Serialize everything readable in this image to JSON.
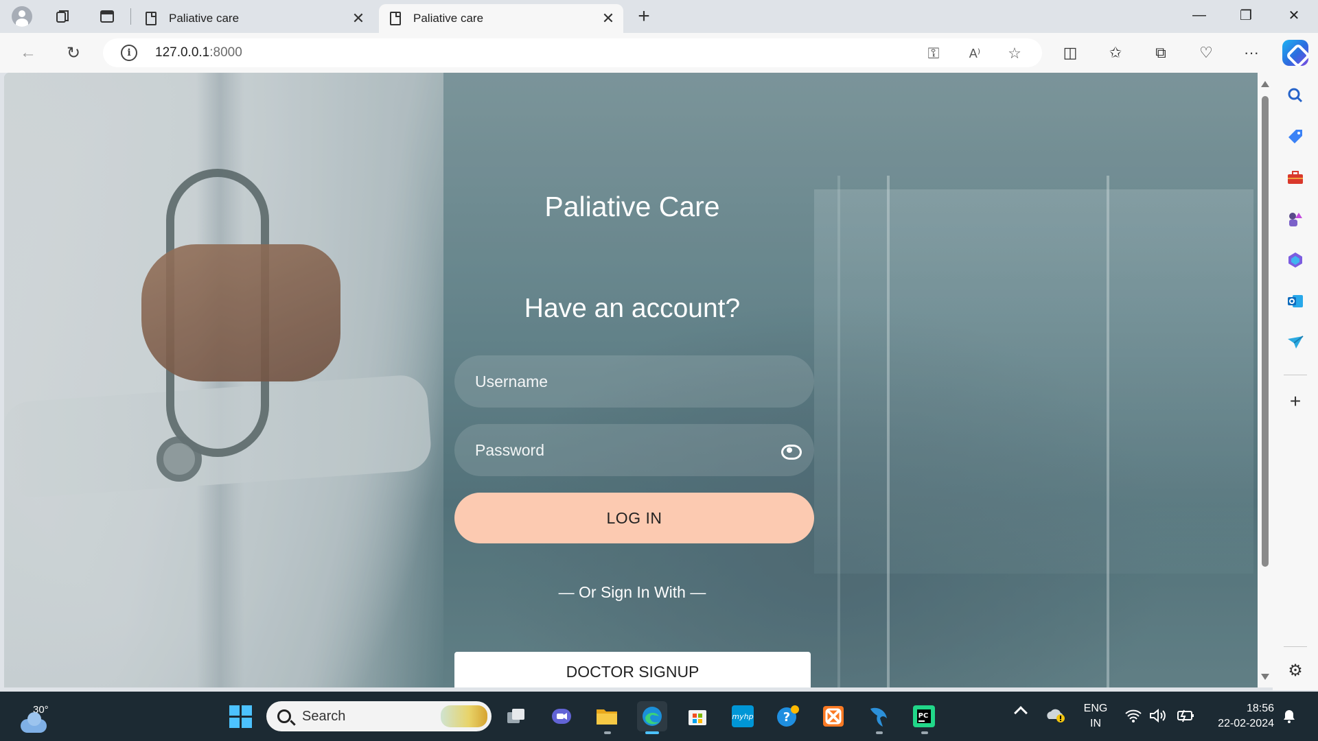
{
  "browser": {
    "tabs": [
      {
        "title": "Paliative care",
        "active": false
      },
      {
        "title": "Paliative care",
        "active": true
      }
    ],
    "address": {
      "host": "127.0.0.1",
      "port": ":8000"
    }
  },
  "page": {
    "brand": "Paliative Care",
    "subheading": "Have an account?",
    "username_placeholder": "Username",
    "password_placeholder": "Password",
    "login_label": "LOG IN",
    "or_sign_in_with": "— Or Sign In With —",
    "doctor_signup_label": "DOCTOR SIGNUP",
    "accent_color": "#fccab1"
  },
  "taskbar": {
    "weather_temp": "30°",
    "search_label": "Search",
    "language_line1": "ENG",
    "language_line2": "IN",
    "time": "18:56",
    "date": "22-02-2024"
  }
}
